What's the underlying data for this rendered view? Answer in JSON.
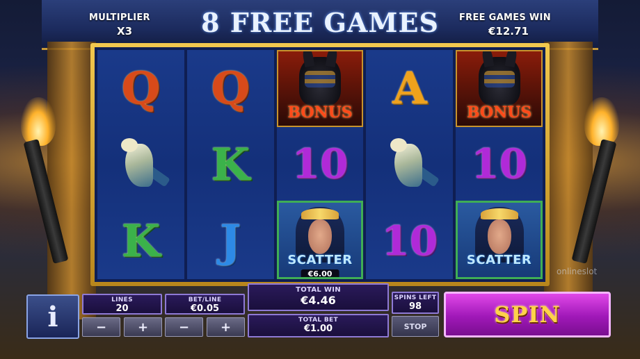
{
  "header": {
    "multiplier_label": "MULTIPLIER",
    "multiplier_value": "X3",
    "title": "8 FREE GAMES",
    "free_games_win_label": "FREE GAMES WIN",
    "free_games_win_value": "€12.71"
  },
  "reels": [
    [
      "Q",
      "falcon",
      "K"
    ],
    [
      "Q",
      "K",
      "J"
    ],
    [
      "BONUS",
      "10",
      "SCATTER"
    ],
    [
      "A",
      "falcon",
      "10"
    ],
    [
      "BONUS",
      "10",
      "SCATTER"
    ]
  ],
  "symbols": {
    "bonus_text": "BONUS",
    "scatter_text": "SCATTER",
    "scatter_win": "€6.00"
  },
  "watermark": "onlineslot",
  "controls": {
    "info_label": "i",
    "lines_label": "LINES",
    "lines_value": "20",
    "bet_line_label": "BET/LINE",
    "bet_line_value": "€0.05",
    "minus": "−",
    "plus": "+",
    "total_win_label": "TOTAL WIN",
    "total_win_value": "€4.46",
    "total_bet_label": "TOTAL BET",
    "total_bet_value": "€1.00",
    "spins_left_label": "SPINS LEFT",
    "spins_left_value": "98",
    "stop_label": "STOP",
    "spin_label": "SPIN"
  },
  "colors": {
    "frame_gold": "#f2c84e",
    "reel_blue": "#14307a",
    "spin_purple": "#a018b8",
    "scatter_border": "#3fae55"
  }
}
